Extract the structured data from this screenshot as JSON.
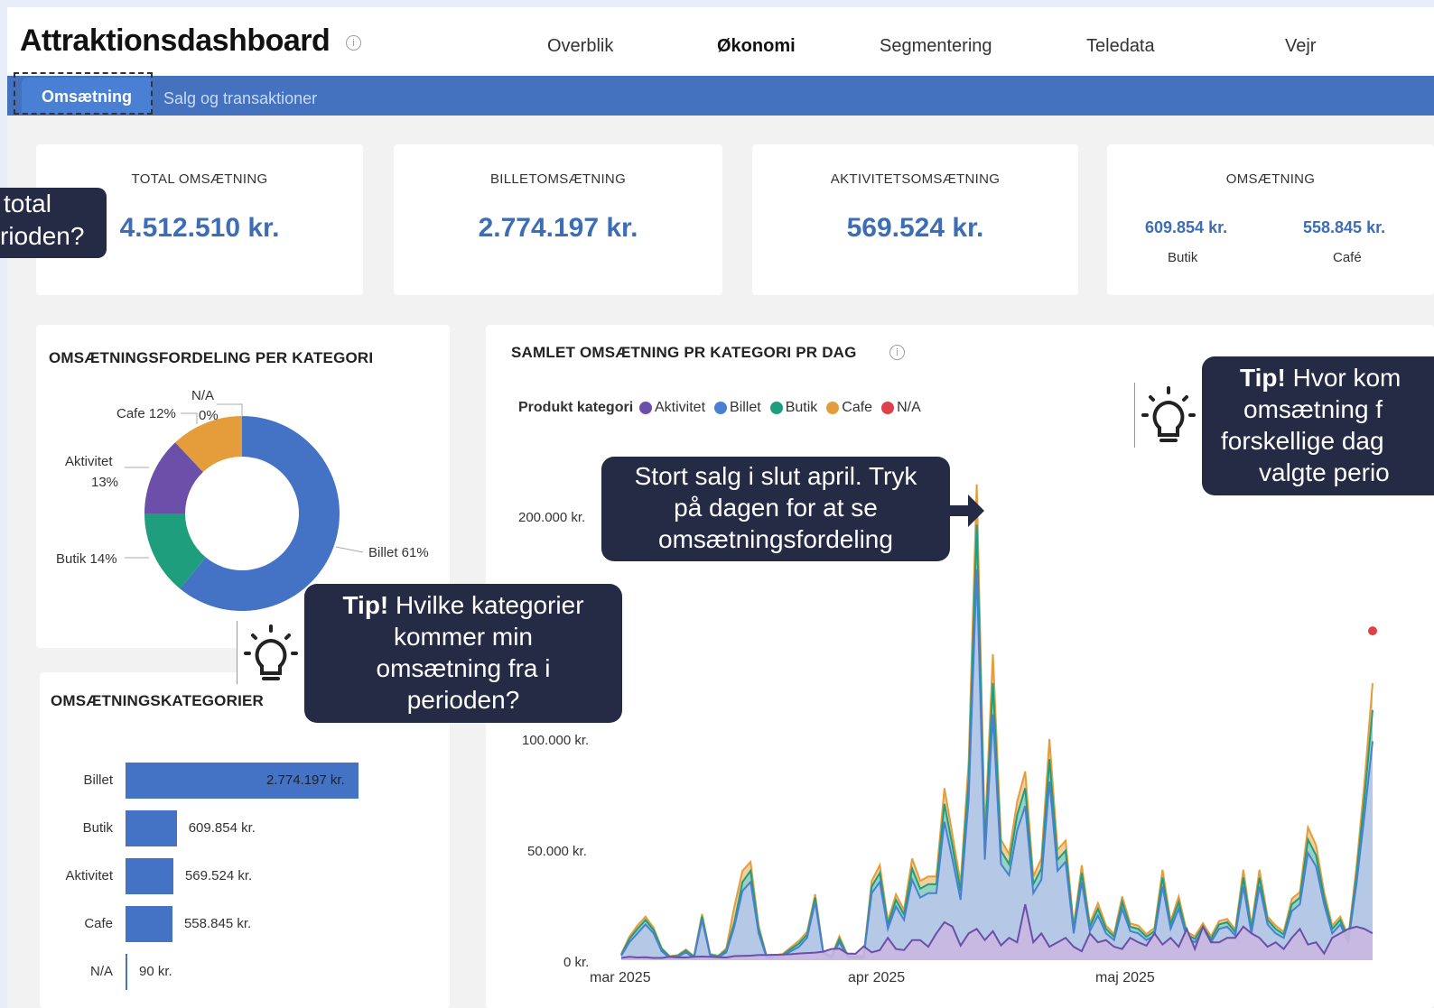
{
  "app": {
    "title": "Attraktionsdashboard",
    "info_glyph": "i"
  },
  "nav": {
    "items": [
      {
        "label": "Overblik"
      },
      {
        "label": "Økonomi"
      },
      {
        "label": "Segmentering"
      },
      {
        "label": "Teledata"
      },
      {
        "label": "Vejr"
      }
    ],
    "active": "Økonomi"
  },
  "subnav": {
    "active_tab": "Omsætning",
    "tab": "Salg og transaktioner"
  },
  "kpis": {
    "total": {
      "label": "TOTAL OMSÆTNING",
      "value": "4.512.510 kr."
    },
    "billet": {
      "label": "BILLETOMSÆTNING",
      "value": "2.774.197 kr."
    },
    "aktivitet": {
      "label": "AKTIVITETSOMSÆTNING",
      "value": "569.524 kr."
    },
    "omsaetning": {
      "label": "OMSÆTNING",
      "butik_value": "609.854 kr.",
      "butik_label": "Butik",
      "cafe_value": "558.845 kr.",
      "cafe_label": "Café"
    }
  },
  "left_callout": {
    "line1": "total",
    "line2": "rioden?"
  },
  "donut": {
    "title": "OMSÆTNINGSFORDELING PER KATEGORI",
    "labels": {
      "na": "N/A",
      "na_pct": "0%",
      "cafe": "Cafe 12%",
      "aktivitet": "Aktivitet",
      "aktivitet_pct": "13%",
      "butik": "Butik 14%",
      "billet": "Billet 61%"
    }
  },
  "bars": {
    "title": "OMSÆTNINGSKATEGORIER",
    "items": [
      {
        "label": "Billet",
        "value": 2774197,
        "text": "2.774.197 kr."
      },
      {
        "label": "Butik",
        "value": 609854,
        "text": "609.854 kr."
      },
      {
        "label": "Aktivitet",
        "value": 569524,
        "text": "569.524 kr."
      },
      {
        "label": "Cafe",
        "value": 558845,
        "text": "558.845 kr."
      },
      {
        "label": "N/A",
        "value": 90,
        "text": "90 kr."
      }
    ]
  },
  "area": {
    "title": "SAMLET OMSÆTNING PR KATEGORI PR DAG",
    "legend_title": "Produkt kategori",
    "legend": [
      {
        "name": "Aktivitet",
        "color": "#6b4fa8"
      },
      {
        "name": "Billet",
        "color": "#4a80d4"
      },
      {
        "name": "Butik",
        "color": "#1f9e7e"
      },
      {
        "name": "Cafe",
        "color": "#e59c3a"
      },
      {
        "name": "N/A",
        "color": "#e0404a"
      }
    ],
    "y_ticks": [
      "0 kr.",
      "50.000 kr.",
      "100.000 kr.",
      "200.000 kr."
    ],
    "x_ticks": [
      "mar 2025",
      "apr 2025",
      "maj 2025"
    ]
  },
  "tips": {
    "donut": {
      "strong": "Tip!",
      "rest1": " Hvilke kategorier",
      "line2": "kommer min",
      "line3": "omsætning fra i",
      "line4": "perioden?"
    },
    "area": {
      "strong": "Tip!",
      "rest1": " Hvor kom",
      "line2": "omsætning f",
      "line3": "forskellige dag",
      "line4": "valgte perio"
    },
    "sale": {
      "line1": "Stort salg i slut april. Tryk",
      "line2": "på dagen for at se",
      "line3": "omsætningsfordeling"
    }
  },
  "chart_data": [
    {
      "type": "pie",
      "title": "OMSÆTNINGSFORDELING PER KATEGORI",
      "categories": [
        "Billet",
        "Butik",
        "Aktivitet",
        "Cafe",
        "N/A"
      ],
      "values": [
        61,
        14,
        13,
        12,
        0
      ],
      "colors": [
        "#4472c4",
        "#1f9e7e",
        "#6b4fa8",
        "#e59c3a",
        "#e0404a"
      ]
    },
    {
      "type": "bar",
      "title": "OMSÆTNINGSKATEGORIER",
      "categories": [
        "Billet",
        "Butik",
        "Aktivitet",
        "Cafe",
        "N/A"
      ],
      "values": [
        2774197,
        609854,
        569524,
        558845,
        90
      ]
    },
    {
      "type": "area",
      "title": "SAMLET OMSÆTNING PR KATEGORI PR DAG",
      "x_ticks": [
        "mar 2025",
        "apr 2025",
        "maj 2025"
      ],
      "ylim": [
        0,
        240000
      ],
      "series": [
        {
          "name": "Aktivitet",
          "values": [
            1000,
            1500,
            1200,
            1300,
            1000,
            1000,
            1500,
            1200,
            1200,
            1500,
            1600,
            1500,
            1300,
            1200,
            1800,
            1900,
            2000,
            2300,
            2300,
            2400,
            2500,
            2700,
            3000,
            3200,
            3400,
            3800,
            5000,
            5200,
            3000,
            2900,
            6200,
            3500,
            4500,
            10000,
            5000,
            4500,
            9000,
            9000,
            6000,
            12000,
            17000,
            15000,
            6500,
            12000,
            14000,
            9000,
            13000,
            6600,
            10000,
            8000,
            25000,
            8000,
            12000,
            6000,
            8000,
            10000,
            6000,
            4000,
            12000,
            8000,
            9000,
            6000,
            5000,
            10000,
            8000,
            6500,
            12000,
            7000,
            10000,
            6000,
            14000,
            5000,
            15000,
            8000,
            8000,
            10000,
            10000,
            15000,
            12000,
            10000,
            6000,
            8000,
            5000,
            10000,
            14000,
            7000,
            8000,
            3000,
            10000,
            12000,
            14000,
            15000,
            14000,
            12000
          ]
        },
        {
          "name": "Billet",
          "values": [
            2000,
            8000,
            12000,
            16000,
            12000,
            4000,
            1000,
            1500,
            3500,
            1000,
            18000,
            2000,
            1200,
            3500,
            15000,
            31000,
            35000,
            12000,
            1000,
            1500,
            2000,
            4000,
            6000,
            10000,
            26000,
            3000,
            1000,
            8000,
            1500,
            1000,
            1200,
            30000,
            35000,
            14000,
            24000,
            18000,
            36000,
            28000,
            30000,
            30000,
            62000,
            45000,
            27000,
            72000,
            175000,
            45000,
            110000,
            43000,
            38000,
            58000,
            69000,
            30000,
            36000,
            80000,
            40000,
            44000,
            12000,
            35000,
            13000,
            20000,
            12000,
            9000,
            23000,
            13000,
            12000,
            9000,
            11000,
            33000,
            14000,
            23000,
            10000,
            8000,
            13000,
            8000,
            14000,
            15000,
            11000,
            33000,
            12000,
            33000,
            16000,
            12000,
            10000,
            22000,
            25000,
            48000,
            42000,
            25000,
            12000,
            16000,
            8000,
            34000,
            65000,
            98000
          ]
        },
        {
          "name": "Butik",
          "values": [
            500,
            1500,
            2000,
            2000,
            1500,
            1000,
            500,
            500,
            800,
            500,
            1500,
            500,
            500,
            1000,
            2000,
            4000,
            5000,
            2000,
            500,
            500,
            500,
            1000,
            1500,
            1500,
            2000,
            500,
            500,
            1500,
            500,
            500,
            500,
            3000,
            4000,
            2000,
            3000,
            2500,
            5000,
            4000,
            4000,
            4000,
            8000,
            6000,
            4000,
            9000,
            20000,
            6000,
            14000,
            6000,
            5000,
            7000,
            8000,
            4000,
            5000,
            10000,
            5000,
            5000,
            2000,
            4000,
            2000,
            3000,
            2000,
            1500,
            3000,
            2000,
            2000,
            1500,
            2000,
            4000,
            2000,
            3000,
            1500,
            1500,
            2000,
            1500,
            2000,
            2000,
            1500,
            4000,
            2000,
            4000,
            2000,
            2000,
            1500,
            3000,
            3000,
            6000,
            5000,
            3000,
            2000,
            2000,
            1500,
            4000,
            8000,
            14000
          ]
        },
        {
          "name": "Cafe",
          "values": [
            300,
            1000,
            1500,
            1500,
            1000,
            500,
            300,
            300,
            500,
            300,
            1200,
            300,
            300,
            800,
            7000,
            5000,
            4000,
            1500,
            300,
            300,
            300,
            800,
            1200,
            1200,
            1500,
            300,
            300,
            1200,
            300,
            300,
            300,
            2500,
            3500,
            1500,
            2500,
            2000,
            4500,
            3500,
            3500,
            3500,
            7000,
            5000,
            3500,
            8000,
            18000,
            5000,
            13000,
            5000,
            4500,
            6000,
            7500,
            3500,
            4500,
            9000,
            4500,
            4500,
            1500,
            3500,
            1500,
            2500,
            1500,
            1200,
            2500,
            1500,
            1500,
            1200,
            1500,
            3500,
            1500,
            2500,
            1200,
            1200,
            1500,
            1200,
            1500,
            1500,
            1200,
            3500,
            1500,
            3500,
            1500,
            1500,
            1200,
            2500,
            2500,
            5500,
            4500,
            2500,
            1500,
            1500,
            1200,
            3500,
            7000,
            12000
          ]
        },
        {
          "name": "N/A",
          "values": [
            0,
            0,
            0,
            0,
            0,
            0,
            0,
            0,
            0,
            0,
            0,
            0,
            0,
            0,
            0,
            0,
            0,
            0,
            0,
            0,
            0,
            0,
            0,
            0,
            0,
            0,
            0,
            0,
            0,
            0,
            0,
            0,
            0,
            0,
            0,
            0,
            0,
            0,
            0,
            0,
            0,
            0,
            0,
            0,
            0,
            0,
            0,
            0,
            0,
            0,
            0,
            0,
            0,
            0,
            0,
            0,
            0,
            0,
            0,
            0,
            0,
            0,
            0,
            0,
            0,
            0,
            0,
            0,
            0,
            0,
            0,
            0,
            0,
            0,
            0,
            0,
            0,
            0,
            0,
            0,
            0,
            0,
            0,
            0,
            0,
            0,
            0,
            0,
            0,
            0,
            0,
            0,
            0,
            90
          ]
        }
      ]
    }
  ]
}
